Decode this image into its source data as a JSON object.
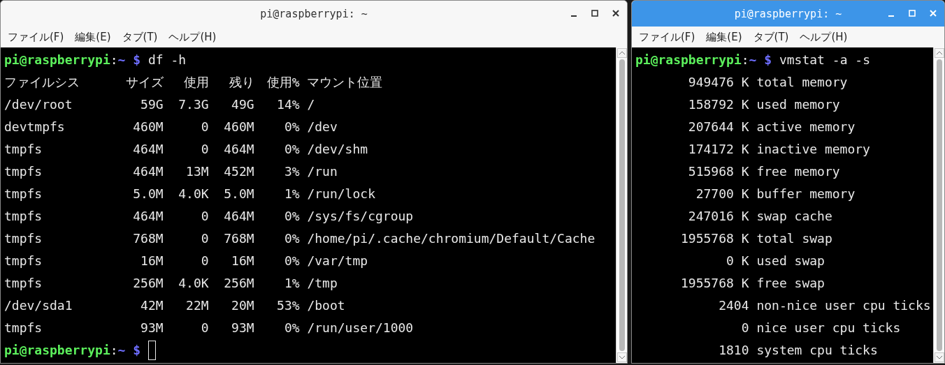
{
  "windows": [
    {
      "title": "pi@raspberrypi: ~",
      "active": false,
      "menu": [
        "ファイル(F)",
        "編集(E)",
        "タブ(T)",
        "ヘルプ(H)"
      ],
      "prompt": {
        "user_host": "pi@raspberrypi",
        "separator": ":",
        "path": "~",
        "symbol": "$",
        "command": "df -h"
      },
      "output": {
        "kind": "table",
        "columns": [
          "ファイルシス",
          "サイズ",
          "使用",
          "残り",
          "使用%",
          "マウント位置"
        ],
        "rows": [
          [
            "/dev/root",
            "59G",
            "7.3G",
            "49G",
            "14%",
            "/"
          ],
          [
            "devtmpfs",
            "460M",
            "0",
            "460M",
            "0%",
            "/dev"
          ],
          [
            "tmpfs",
            "464M",
            "0",
            "464M",
            "0%",
            "/dev/shm"
          ],
          [
            "tmpfs",
            "464M",
            "13M",
            "452M",
            "3%",
            "/run"
          ],
          [
            "tmpfs",
            "5.0M",
            "4.0K",
            "5.0M",
            "1%",
            "/run/lock"
          ],
          [
            "tmpfs",
            "464M",
            "0",
            "464M",
            "0%",
            "/sys/fs/cgroup"
          ],
          [
            "tmpfs",
            "768M",
            "0",
            "768M",
            "0%",
            "/home/pi/.cache/chromium/Default/Cache"
          ],
          [
            "tmpfs",
            "16M",
            "0",
            "16M",
            "0%",
            "/var/tmp"
          ],
          [
            "tmpfs",
            "256M",
            "4.0K",
            "256M",
            "1%",
            "/tmp"
          ],
          [
            "/dev/sda1",
            "42M",
            "22M",
            "20M",
            "53%",
            "/boot"
          ],
          [
            "tmpfs",
            "93M",
            "0",
            "93M",
            "0%",
            "/run/user/1000"
          ]
        ]
      },
      "final_prompt": {
        "user_host": "pi@raspberrypi",
        "separator": ":",
        "path": "~",
        "symbol": "$",
        "cursor": true
      }
    },
    {
      "title": "pi@raspberrypi: ~",
      "active": true,
      "menu": [
        "ファイル(F)",
        "編集(E)",
        "タブ(T)",
        "ヘルプ(H)"
      ],
      "prompt": {
        "user_host": "pi@raspberrypi",
        "separator": ":",
        "path": "~",
        "symbol": "$",
        "command": "vmstat -a -s"
      },
      "output": {
        "kind": "stats",
        "items": [
          {
            "amount": "949476 K",
            "description": "total memory"
          },
          {
            "amount": "158792 K",
            "description": "used memory"
          },
          {
            "amount": "207644 K",
            "description": "active memory"
          },
          {
            "amount": "174172 K",
            "description": "inactive memory"
          },
          {
            "amount": "515968 K",
            "description": "free memory"
          },
          {
            "amount": "27700 K",
            "description": "buffer memory"
          },
          {
            "amount": "247016 K",
            "description": "swap cache"
          },
          {
            "amount": "1955768 K",
            "description": "total swap"
          },
          {
            "amount": "0 K",
            "description": "used swap"
          },
          {
            "amount": "1955768 K",
            "description": "free swap"
          },
          {
            "amount": "2404",
            "description": "non-nice user cpu ticks"
          },
          {
            "amount": "0",
            "description": "nice user cpu ticks"
          },
          {
            "amount": "1810",
            "description": "system cpu ticks"
          }
        ]
      }
    }
  ]
}
